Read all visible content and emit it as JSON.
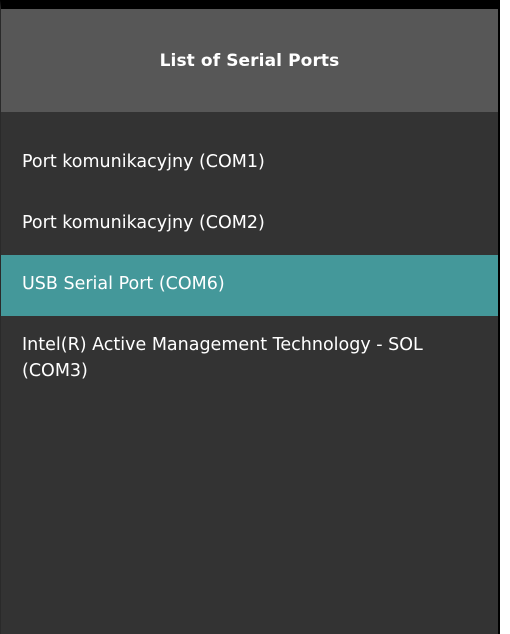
{
  "header": {
    "title": "List of Serial Ports"
  },
  "ports": {
    "items": [
      {
        "label": "Port komunikacyjny (COM1)"
      },
      {
        "label": "Port komunikacyjny (COM2)"
      },
      {
        "label": "USB Serial Port (COM6)"
      },
      {
        "label": "Intel(R) Active Management Technology - SOL (COM3)"
      }
    ],
    "selected_index": 2
  },
  "colors": {
    "header_bg": "#575757",
    "panel_bg": "#333333",
    "selection_accent": "#44989a",
    "text": "#ffffff"
  }
}
